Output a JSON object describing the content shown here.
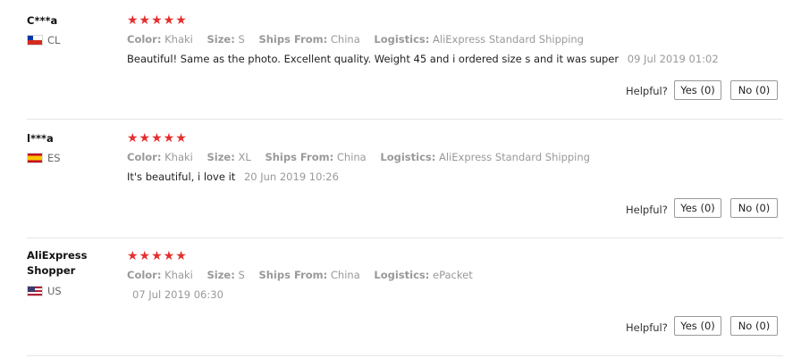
{
  "labels": {
    "color": "Color:",
    "size": "Size:",
    "ships_from": "Ships From:",
    "logistics": "Logistics:",
    "helpful": "Helpful?"
  },
  "reviews": [
    {
      "user": "C***a",
      "country": "CL",
      "flag_icon": "chile-flag-icon",
      "stars": "★★★★★",
      "rating": 5,
      "color": "Khaki",
      "size": "S",
      "ships_from": "China",
      "logistics": "AliExpress Standard Shipping",
      "text": "Beautiful! Same as the photo. Excellent quality. Weight 45 and i ordered size s and it was super",
      "date": "09 Jul 2019 01:02",
      "yes_label": "Yes (0)",
      "no_label": "No (0)"
    },
    {
      "user": "l***a",
      "country": "ES",
      "flag_icon": "spain-flag-icon",
      "stars": "★★★★★",
      "rating": 5,
      "color": "Khaki",
      "size": "XL",
      "ships_from": "China",
      "logistics": "AliExpress Standard Shipping",
      "text": "It's beautiful, i love it",
      "date": "20 Jun 2019 10:26",
      "yes_label": "Yes (0)",
      "no_label": "No (0)"
    },
    {
      "user": "AliExpress Shopper",
      "country": "US",
      "flag_icon": "usa-flag-icon",
      "stars": "★★★★★",
      "rating": 5,
      "color": "Khaki",
      "size": "S",
      "ships_from": "China",
      "logistics": "ePacket",
      "text": "",
      "date": "07 Jul 2019 06:30",
      "yes_label": "Yes (0)",
      "no_label": "No (0)"
    }
  ]
}
